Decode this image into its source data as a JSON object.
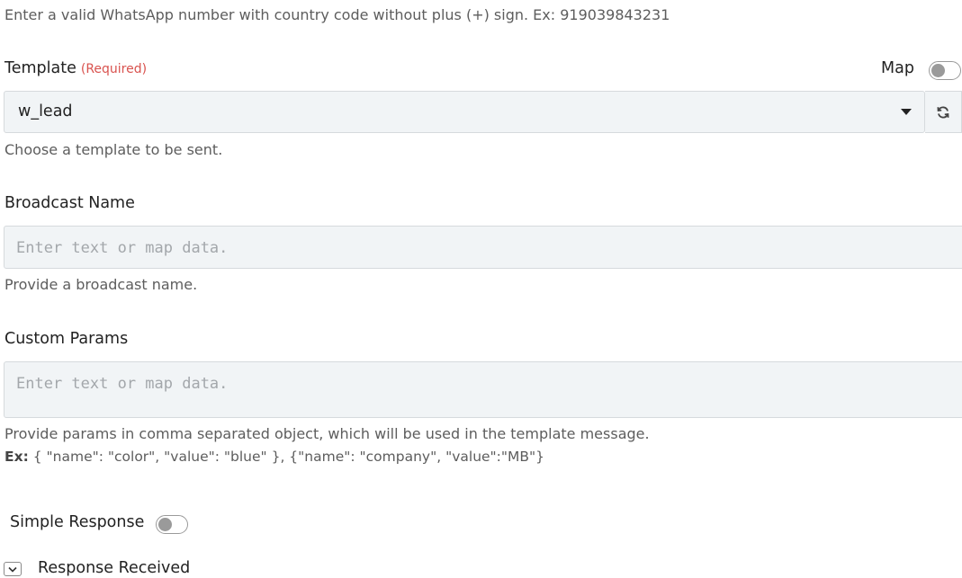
{
  "phone": {
    "help": "Enter a valid WhatsApp number with country code without plus (+) sign. Ex: 919039843231"
  },
  "template": {
    "label": "Template",
    "required": "(Required)",
    "map_label": "Map",
    "map_enabled": false,
    "value": "w_lead",
    "help": "Choose a template to be sent."
  },
  "broadcast": {
    "label": "Broadcast Name",
    "placeholder": "Enter text or map data.",
    "help": "Provide a broadcast name."
  },
  "custom_params": {
    "label": "Custom Params",
    "placeholder": "Enter text or map data.",
    "help": "Provide params in comma separated object, which will be used in the template message.",
    "example_prefix": "Ex:",
    "example": " { \"name\": \"color\", \"value\": \"blue\" }, {\"name\": \"company\", \"value\":\"MB\"}"
  },
  "simple_response": {
    "label": "Simple Response",
    "enabled": false
  },
  "response_received": {
    "label": "Response Received"
  },
  "icons": {
    "refresh": "refresh-icon",
    "caret": "caret-down-icon",
    "chevron": "chevron-down-icon"
  },
  "colors": {
    "required": "#d9534f",
    "field_bg": "#f1f4f6",
    "toggle_off": "#9a9a9a"
  }
}
